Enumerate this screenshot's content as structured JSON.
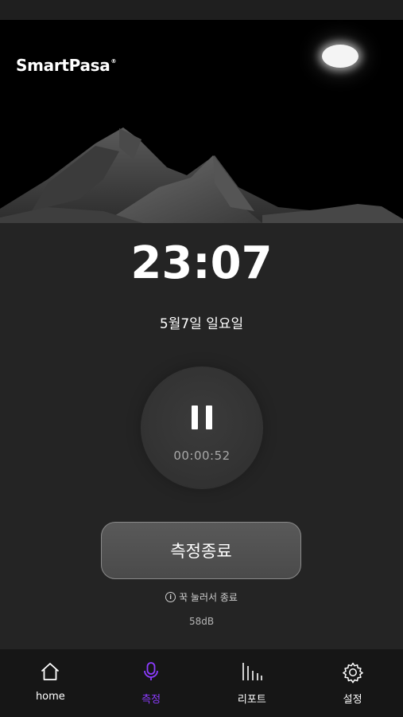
{
  "app": {
    "logo": "SmartPasa",
    "logo_mark": "®"
  },
  "clock": {
    "time": "23:07",
    "date": "5월7일 일요일"
  },
  "recording": {
    "elapsed": "00:00:52",
    "state": "paused"
  },
  "controls": {
    "stop_label": "측정종료",
    "hint_icon": "i",
    "hint": "꾹 눌러서 종료",
    "decibel": "58dB"
  },
  "nav": {
    "items": [
      {
        "label": "home",
        "icon": "home-icon"
      },
      {
        "label": "측정",
        "icon": "microphone-icon",
        "active": true
      },
      {
        "label": "리포트",
        "icon": "report-bars-icon"
      },
      {
        "label": "설정",
        "icon": "gear-icon"
      }
    ]
  },
  "colors": {
    "accent": "#8c3cff",
    "background": "#242424",
    "nav_background": "#161616"
  }
}
